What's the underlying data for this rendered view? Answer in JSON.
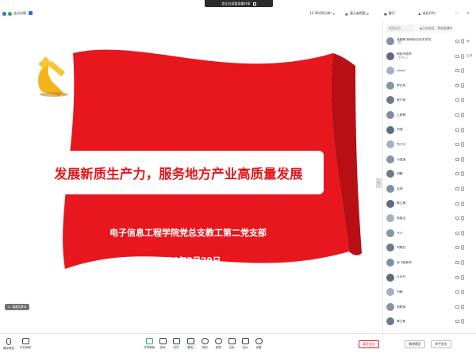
{
  "window": {
    "title": "悠正在观看屏幕共享"
  },
  "topbar": {
    "meeting_label": "会议详情",
    "network": "11:09(60分钟)",
    "view_label": "演示者视图",
    "chat_tab": "聊天",
    "members_tab": "成员(20)"
  },
  "slide": {
    "title": "发展新质生产力，服务地方产业高质量发展",
    "org": "电子信息工程学院党总支教工第二党支部",
    "date": "2024年3月29日",
    "chip": "观看共享中"
  },
  "panel": {
    "search_placeholder": "搜索成员",
    "notice": "正在讲话，等候录播中",
    "members": [
      {
        "name": "张婉婷-柳州职业技术学院",
        "sub": "(我)",
        "tag": "我",
        "cam": true
      },
      {
        "name": "杨丽萍老师",
        "sub": "(主持人)",
        "tag": "主持",
        "cam": true
      },
      {
        "name": "Lewis",
        "sub": "",
        "tag": "",
        "cam": true
      },
      {
        "name": "李文杰",
        "sub": "",
        "tag": "",
        "cam": true
      },
      {
        "name": "黄小泉",
        "sub": "",
        "tag": "",
        "cam": true
      },
      {
        "name": "王婷婷",
        "sub": "",
        "tag": "",
        "cam": true
      },
      {
        "name": "刘瑾",
        "sub": "",
        "tag": "",
        "cam": true
      },
      {
        "name": "韦只行",
        "sub": "",
        "tag": "",
        "cam": true
      },
      {
        "name": "马盈盈",
        "sub": "",
        "tag": "",
        "cam": true
      },
      {
        "name": "胡敏",
        "sub": "",
        "tag": "",
        "cam": true
      },
      {
        "name": "吴迪",
        "sub": "",
        "tag": "",
        "cam": true
      },
      {
        "name": "覃玉梅",
        "sub": "",
        "tag": "",
        "cam": true
      },
      {
        "name": "黄晨呈",
        "sub": "",
        "tag": "",
        "cam": true
      },
      {
        "name": "兴子",
        "sub": "",
        "tag": "",
        "cam": true
      },
      {
        "name": "何晓红",
        "sub": "",
        "tag": "",
        "cam": true
      },
      {
        "name": "张飞翔老师",
        "sub": "",
        "tag": "",
        "cam": true
      },
      {
        "name": "孔丹丹",
        "sub": "",
        "tag": "",
        "cam": true
      },
      {
        "name": "刘静",
        "sub": "",
        "tag": "",
        "cam": true
      },
      {
        "name": "周晓丽",
        "sub": "",
        "tag": "",
        "cam": true
      },
      {
        "name": "覃立新",
        "sub": "",
        "tag": "",
        "cam": true
      }
    ]
  },
  "toolbar": {
    "left": [
      {
        "label": "解除静音"
      },
      {
        "label": "开启视频"
      }
    ],
    "center": [
      {
        "label": "共享屏幕"
      },
      {
        "label": "邀请"
      },
      {
        "label": "成员"
      },
      {
        "label": "聊天"
      },
      {
        "label": "录制"
      },
      {
        "label": "表情"
      },
      {
        "label": "应用"
      },
      {
        "label": "会议"
      },
      {
        "label": "设置"
      }
    ],
    "leave_label": "离开会议",
    "end_label": "解除静音",
    "raise_label": "举手发言"
  },
  "colors": {
    "accent": "#e4161b",
    "blue": "#2f6fde"
  }
}
